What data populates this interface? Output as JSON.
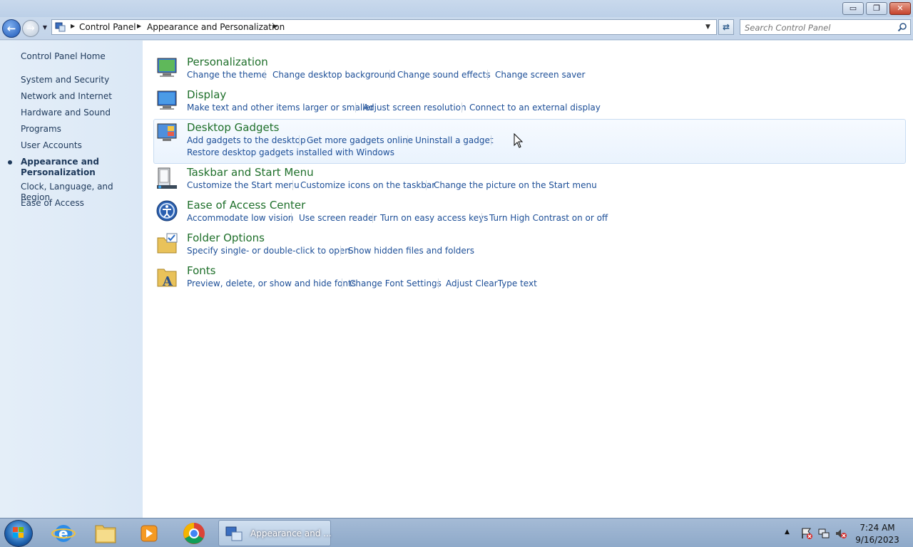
{
  "window": {
    "caption_buttons": {
      "minimize": "▭",
      "maximize": "❐",
      "close": "✕"
    }
  },
  "navbar": {
    "breadcrumbs": [
      "Control Panel",
      "Appearance and Personalization"
    ],
    "search_placeholder": "Search Control Panel"
  },
  "leftnav": {
    "items": [
      "Control Panel Home",
      "System and Security",
      "Network and Internet",
      "Hardware and Sound",
      "Programs",
      "User Accounts",
      "Appearance and Personalization",
      "Clock, Language, and Region",
      "Ease of Access"
    ],
    "current_index": 6
  },
  "categories": [
    {
      "title": "Personalization",
      "icon": "personalization-icon",
      "links": [
        "Change the theme",
        "Change desktop background",
        "Change sound effects",
        "Change screen saver"
      ]
    },
    {
      "title": "Display",
      "icon": "display-icon",
      "links": [
        "Make text and other items larger or smaller",
        "Adjust screen resolution",
        "Connect to an external display"
      ]
    },
    {
      "title": "Desktop Gadgets",
      "icon": "gadgets-icon",
      "links": [
        "Add gadgets to the desktop",
        "Get more gadgets online",
        "Uninstall a gadget",
        "Restore desktop gadgets installed with Windows"
      ]
    },
    {
      "title": "Taskbar and Start Menu",
      "icon": "taskbar-icon",
      "links": [
        "Customize the Start menu",
        "Customize icons on the taskbar",
        "Change the picture on the Start menu"
      ]
    },
    {
      "title": "Ease of Access Center",
      "icon": "ease-of-access-icon",
      "links": [
        "Accommodate low vision",
        "Use screen reader",
        "Turn on easy access keys",
        "Turn High Contrast on or off"
      ]
    },
    {
      "title": "Folder Options",
      "icon": "folder-options-icon",
      "links": [
        "Specify single- or double-click to open",
        "Show hidden files and folders"
      ]
    },
    {
      "title": "Fonts",
      "icon": "fonts-icon",
      "links": [
        "Preview, delete, or show and hide fonts",
        "Change Font Settings",
        "Adjust ClearType text"
      ]
    }
  ],
  "taskbar": {
    "pinned": [
      "internet-explorer-icon",
      "windows-explorer-icon",
      "media-player-icon",
      "chrome-icon"
    ],
    "active_window": "Appearance and ...",
    "tray_arrow": "▲",
    "time": "7:24 AM",
    "date": "9/16/2023"
  },
  "colors": {
    "category_title": "#1e6f2a",
    "link": "#1c4e97",
    "nav_text": "#1e395b"
  }
}
